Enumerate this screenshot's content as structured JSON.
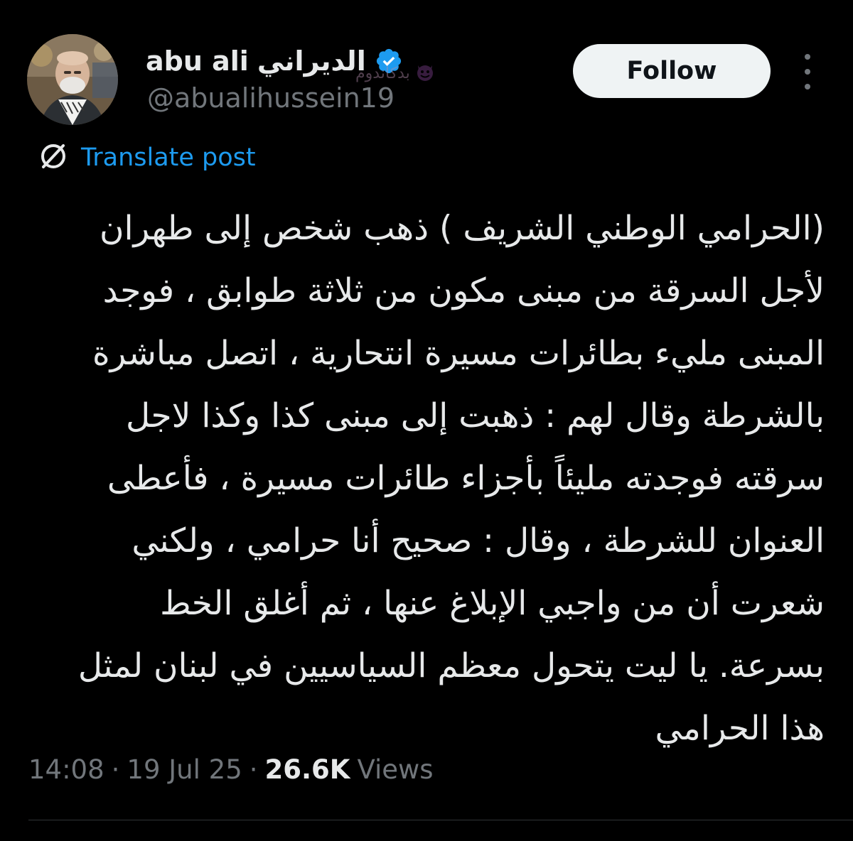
{
  "author": {
    "name_latin": "abu ali",
    "name_arabic": "الديراني",
    "handle": "@abualihussein19",
    "verified_color": "#1d9bf0",
    "avatar_icon": "profile-photo"
  },
  "watermark": {
    "text": "بدكاندوم",
    "icon": "devil-emoji-icon"
  },
  "follow": {
    "label": "Follow"
  },
  "more": {
    "icon": "more-vertical-icon"
  },
  "translate": {
    "label": "Translate post",
    "icon": "translate-globe-icon"
  },
  "post": {
    "lines": [
      "(الحرامي الوطني الشريف ) ذهب شخص إلى طهران",
      "لأجل السرقة من مبنى مكون من ثلاثة طوابق ، فوجد",
      "المبنى مليء بطائرات مسيرة انتحارية ، اتصل مباشرة",
      "بالشرطة وقال لهم : ذهبت إلى مبنى كذا وكذا لاجل",
      "سرقته فوجدته مليئاً بأجزاء طائرات مسيرة ، فأعطى",
      "العنوان للشرطة ، وقال : صحيح أنا حرامي ، ولكني",
      "شعرت أن من واجبي الإبلاغ عنها ، ثم أغلق الخط",
      "بسرعة. يا ليت يتحول معظم السياسيين في لبنان لمثل",
      "هذا الحرامي"
    ]
  },
  "meta": {
    "time": "14:08",
    "date": "19 Jul 25",
    "separator": "·",
    "views_count": "26.6K",
    "views_label": "Views"
  },
  "colors": {
    "background": "#000000",
    "text": "#e7e9ea",
    "secondary": "#71767b",
    "accent": "#1d9bf0",
    "button_bg": "#eff3f4"
  }
}
